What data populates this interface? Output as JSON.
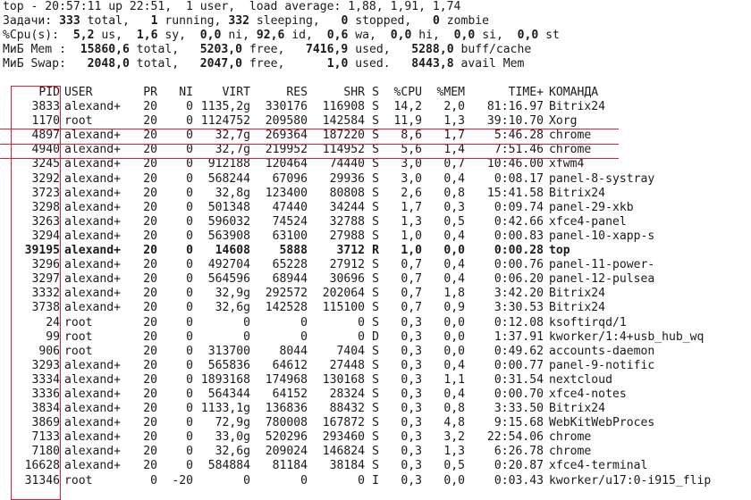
{
  "summary": {
    "line1": "top - 20:57:11 up 22:51,  1 user,  load average: 1,88, 1,91, 1,74",
    "tasks": [
      {
        "t": "Задачи: ",
        "b": false
      },
      {
        "t": "333",
        "b": true
      },
      {
        "t": " total,   ",
        "b": false
      },
      {
        "t": "1",
        "b": true
      },
      {
        "t": " running, ",
        "b": false
      },
      {
        "t": "332",
        "b": true
      },
      {
        "t": " sleeping,   ",
        "b": false
      },
      {
        "t": "0",
        "b": true
      },
      {
        "t": " stopped,   ",
        "b": false
      },
      {
        "t": "0",
        "b": true
      },
      {
        "t": " zombie",
        "b": false
      }
    ],
    "cpu": [
      {
        "t": "%Cpu(s):  ",
        "b": false
      },
      {
        "t": "5,2",
        "b": true
      },
      {
        "t": " us,  ",
        "b": false
      },
      {
        "t": "1,6",
        "b": true
      },
      {
        "t": " sy,  ",
        "b": false
      },
      {
        "t": "0,0",
        "b": true
      },
      {
        "t": " ni, ",
        "b": false
      },
      {
        "t": "92,6",
        "b": true
      },
      {
        "t": " id,  ",
        "b": false
      },
      {
        "t": "0,6",
        "b": true
      },
      {
        "t": " wa,  ",
        "b": false
      },
      {
        "t": "0,0",
        "b": true
      },
      {
        "t": " hi,  ",
        "b": false
      },
      {
        "t": "0,0",
        "b": true
      },
      {
        "t": " si,  ",
        "b": false
      },
      {
        "t": "0,0",
        "b": true
      },
      {
        "t": " st",
        "b": false
      }
    ],
    "mem": [
      {
        "t": "МиБ Mem :  ",
        "b": false
      },
      {
        "t": "15860,6",
        "b": true
      },
      {
        "t": " total,   ",
        "b": false
      },
      {
        "t": "5203,0",
        "b": true
      },
      {
        "t": " free,   ",
        "b": false
      },
      {
        "t": "7416,9",
        "b": true
      },
      {
        "t": " used,   ",
        "b": false
      },
      {
        "t": "5288,0",
        "b": true
      },
      {
        "t": " buff/cache",
        "b": false
      }
    ],
    "swap": [
      {
        "t": "МиБ Swap:   ",
        "b": false
      },
      {
        "t": "2048,0",
        "b": true
      },
      {
        "t": " total,   ",
        "b": false
      },
      {
        "t": "2047,0",
        "b": true
      },
      {
        "t": " free,      ",
        "b": false
      },
      {
        "t": "1,0",
        "b": true
      },
      {
        "t": " used.   ",
        "b": false
      },
      {
        "t": "8443,8",
        "b": true
      },
      {
        "t": " avail Mem",
        "b": false
      }
    ]
  },
  "columns": [
    "PID",
    "USER",
    "PR",
    "NI",
    "VIRT",
    "RES",
    "SHR",
    "S",
    "%CPU",
    "%MEM",
    "TIME+",
    "КОМАНДА"
  ],
  "processes": [
    {
      "pid": "3833",
      "user": "alexand+",
      "pr": "20",
      "ni": "0",
      "virt": "1135,2g",
      "res": "330176",
      "shr": "116908",
      "s": "S",
      "cpu": "14,2",
      "mem": "2,0",
      "time": "81:16.97",
      "cmd": "Bitrix24"
    },
    {
      "pid": "1170",
      "user": "root",
      "pr": "20",
      "ni": "0",
      "virt": "1124752",
      "res": "209580",
      "shr": "142584",
      "s": "S",
      "cpu": "11,9",
      "mem": "1,3",
      "time": "39:10.70",
      "cmd": "Xorg"
    },
    {
      "pid": "4897",
      "user": "alexand+",
      "pr": "20",
      "ni": "0",
      "virt": "32,7g",
      "res": "269364",
      "shr": "187220",
      "s": "S",
      "cpu": "8,6",
      "mem": "1,7",
      "time": "5:46.28",
      "cmd": "chrome"
    },
    {
      "pid": "4940",
      "user": "alexand+",
      "pr": "20",
      "ni": "0",
      "virt": "32,7g",
      "res": "219952",
      "shr": "114952",
      "s": "S",
      "cpu": "5,6",
      "mem": "1,4",
      "time": "7:51.46",
      "cmd": "chrome"
    },
    {
      "pid": "3245",
      "user": "alexand+",
      "pr": "20",
      "ni": "0",
      "virt": "912188",
      "res": "120464",
      "shr": "74440",
      "s": "S",
      "cpu": "3,0",
      "mem": "0,7",
      "time": "10:46.00",
      "cmd": "xfwm4"
    },
    {
      "pid": "3292",
      "user": "alexand+",
      "pr": "20",
      "ni": "0",
      "virt": "568244",
      "res": "67096",
      "shr": "29936",
      "s": "S",
      "cpu": "3,0",
      "mem": "0,4",
      "time": "0:08.17",
      "cmd": "panel-8-systray"
    },
    {
      "pid": "3723",
      "user": "alexand+",
      "pr": "20",
      "ni": "0",
      "virt": "32,8g",
      "res": "123400",
      "shr": "80808",
      "s": "S",
      "cpu": "2,6",
      "mem": "0,8",
      "time": "15:41.58",
      "cmd": "Bitrix24"
    },
    {
      "pid": "3298",
      "user": "alexand+",
      "pr": "20",
      "ni": "0",
      "virt": "501348",
      "res": "47440",
      "shr": "34244",
      "s": "S",
      "cpu": "1,7",
      "mem": "0,3",
      "time": "0:09.74",
      "cmd": "panel-29-xkb"
    },
    {
      "pid": "3263",
      "user": "alexand+",
      "pr": "20",
      "ni": "0",
      "virt": "596032",
      "res": "74524",
      "shr": "32788",
      "s": "S",
      "cpu": "1,3",
      "mem": "0,5",
      "time": "0:42.66",
      "cmd": "xfce4-panel"
    },
    {
      "pid": "3294",
      "user": "alexand+",
      "pr": "20",
      "ni": "0",
      "virt": "563908",
      "res": "63100",
      "shr": "27988",
      "s": "S",
      "cpu": "1,0",
      "mem": "0,4",
      "time": "0:00.83",
      "cmd": "panel-10-xapp-s"
    },
    {
      "pid": "39195",
      "user": "alexand+",
      "pr": "20",
      "ni": "0",
      "virt": "14608",
      "res": "5888",
      "shr": "3712",
      "s": "R",
      "cpu": "1,0",
      "mem": "0,0",
      "time": "0:00.28",
      "cmd": "top",
      "bold": true
    },
    {
      "pid": "3296",
      "user": "alexand+",
      "pr": "20",
      "ni": "0",
      "virt": "492704",
      "res": "65228",
      "shr": "27912",
      "s": "S",
      "cpu": "0,7",
      "mem": "0,4",
      "time": "0:00.76",
      "cmd": "panel-11-power-"
    },
    {
      "pid": "3297",
      "user": "alexand+",
      "pr": "20",
      "ni": "0",
      "virt": "564596",
      "res": "68944",
      "shr": "30696",
      "s": "S",
      "cpu": "0,7",
      "mem": "0,4",
      "time": "0:06.20",
      "cmd": "panel-12-pulsea"
    },
    {
      "pid": "3332",
      "user": "alexand+",
      "pr": "20",
      "ni": "0",
      "virt": "32,9g",
      "res": "292572",
      "shr": "202064",
      "s": "S",
      "cpu": "0,7",
      "mem": "1,8",
      "time": "3:42.20",
      "cmd": "Bitrix24"
    },
    {
      "pid": "3738",
      "user": "alexand+",
      "pr": "20",
      "ni": "0",
      "virt": "32,6g",
      "res": "142528",
      "shr": "115100",
      "s": "S",
      "cpu": "0,7",
      "mem": "0,9",
      "time": "3:30.53",
      "cmd": "Bitrix24"
    },
    {
      "pid": "24",
      "user": "root",
      "pr": "20",
      "ni": "0",
      "virt": "0",
      "res": "0",
      "shr": "0",
      "s": "S",
      "cpu": "0,3",
      "mem": "0,0",
      "time": "0:12.08",
      "cmd": "ksoftirqd/1"
    },
    {
      "pid": "99",
      "user": "root",
      "pr": "20",
      "ni": "0",
      "virt": "0",
      "res": "0",
      "shr": "0",
      "s": "D",
      "cpu": "0,3",
      "mem": "0,0",
      "time": "1:37.91",
      "cmd": "kworker/1:4+usb_hub_wq"
    },
    {
      "pid": "906",
      "user": "root",
      "pr": "20",
      "ni": "0",
      "virt": "313700",
      "res": "8044",
      "shr": "7404",
      "s": "S",
      "cpu": "0,3",
      "mem": "0,0",
      "time": "0:49.62",
      "cmd": "accounts-daemon"
    },
    {
      "pid": "3293",
      "user": "alexand+",
      "pr": "20",
      "ni": "0",
      "virt": "565836",
      "res": "64612",
      "shr": "27448",
      "s": "S",
      "cpu": "0,3",
      "mem": "0,4",
      "time": "0:00.77",
      "cmd": "panel-9-notific"
    },
    {
      "pid": "3334",
      "user": "alexand+",
      "pr": "20",
      "ni": "0",
      "virt": "1893168",
      "res": "174968",
      "shr": "130168",
      "s": "S",
      "cpu": "0,3",
      "mem": "1,1",
      "time": "0:31.54",
      "cmd": "nextcloud"
    },
    {
      "pid": "3336",
      "user": "alexand+",
      "pr": "20",
      "ni": "0",
      "virt": "564344",
      "res": "64152",
      "shr": "28324",
      "s": "S",
      "cpu": "0,3",
      "mem": "0,4",
      "time": "0:00.70",
      "cmd": "xfce4-notes"
    },
    {
      "pid": "3834",
      "user": "alexand+",
      "pr": "20",
      "ni": "0",
      "virt": "1133,1g",
      "res": "136836",
      "shr": "88432",
      "s": "S",
      "cpu": "0,3",
      "mem": "0,8",
      "time": "3:33.50",
      "cmd": "Bitrix24"
    },
    {
      "pid": "3869",
      "user": "alexand+",
      "pr": "20",
      "ni": "0",
      "virt": "72,9g",
      "res": "780008",
      "shr": "167872",
      "s": "S",
      "cpu": "0,3",
      "mem": "4,8",
      "time": "9:15.68",
      "cmd": "WebKitWebProces"
    },
    {
      "pid": "7133",
      "user": "alexand+",
      "pr": "20",
      "ni": "0",
      "virt": "33,0g",
      "res": "520296",
      "shr": "293460",
      "s": "S",
      "cpu": "0,3",
      "mem": "3,2",
      "time": "22:54.06",
      "cmd": "chrome"
    },
    {
      "pid": "7180",
      "user": "alexand+",
      "pr": "20",
      "ni": "0",
      "virt": "32,6g",
      "res": "209024",
      "shr": "146824",
      "s": "S",
      "cpu": "0,3",
      "mem": "1,3",
      "time": "6:26.78",
      "cmd": "chrome"
    },
    {
      "pid": "16628",
      "user": "alexand+",
      "pr": "20",
      "ni": "0",
      "virt": "584884",
      "res": "81184",
      "shr": "38184",
      "s": "S",
      "cpu": "0,3",
      "mem": "0,5",
      "time": "0:20.87",
      "cmd": "xfce4-terminal"
    },
    {
      "pid": "31346",
      "user": "root",
      "pr": "0",
      "ni": "-20",
      "virt": "0",
      "res": "0",
      "shr": "0",
      "s": "I",
      "cpu": "0,3",
      "mem": "0,0",
      "time": "0:03.43",
      "cmd": "kworker/u17:0-i915_flip"
    }
  ],
  "colors": {
    "text": "#1a1a1a",
    "background": "#ffffff",
    "highlight": "#e0222a"
  }
}
